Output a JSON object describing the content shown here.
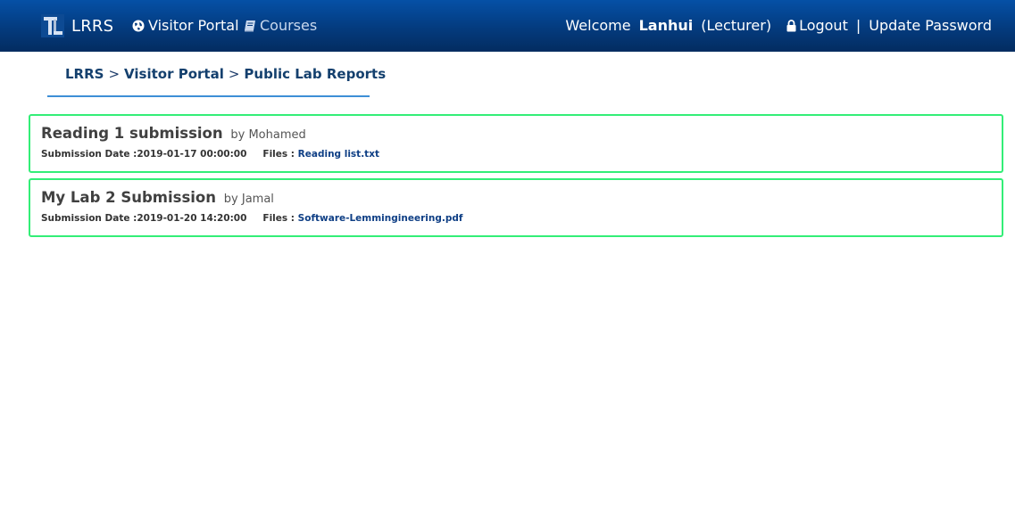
{
  "navbar": {
    "brand": "LRRS",
    "visitor_portal": "Visitor Portal",
    "courses": "Courses",
    "welcome": "Welcome",
    "username": "Lanhui",
    "role": "(Lecturer)",
    "logout": "Logout",
    "separator": "|",
    "update_password": "Update Password"
  },
  "breadcrumb": {
    "items": [
      "LRRS",
      "Visitor Portal",
      "Public Lab Reports"
    ],
    "separator": ">"
  },
  "reports": [
    {
      "title": "Reading 1 submission",
      "by": "by Mohamed",
      "date_label": "Submission Date :",
      "date": "2019-01-17 00:00:00",
      "files_label": "Files :",
      "file": "Reading list.txt"
    },
    {
      "title": "My Lab 2 Submission",
      "by": "by Jamal",
      "date_label": "Submission Date :",
      "date": "2019-01-20 14:20:00",
      "files_label": "Files :",
      "file": "Software-Lemmingineering.pdf"
    }
  ],
  "colors": {
    "navbar_top": "#0550a6",
    "navbar_bottom": "#032c60",
    "card_border": "#33ee77",
    "breadcrumb_underline": "#3d8fd6",
    "link": "#0f3f85"
  },
  "icons": {
    "brand": "lrrs-logo-icon",
    "visitor_portal": "globe-icon",
    "courses": "book-icon",
    "logout": "lock-icon"
  }
}
